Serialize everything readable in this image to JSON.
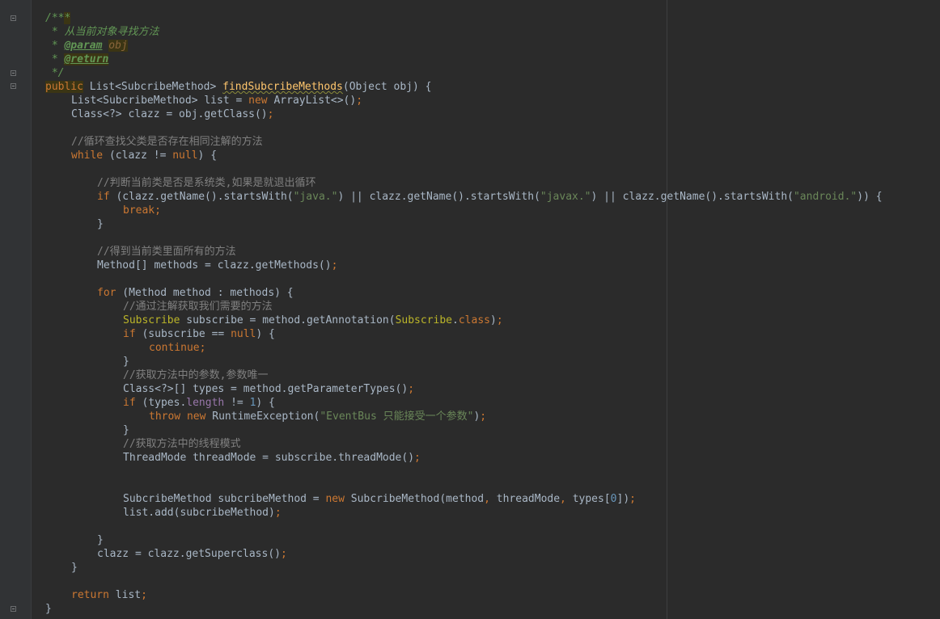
{
  "editor": {
    "language": "java",
    "lines": [
      {
        "indent": 56,
        "segs": [
          {
            "t": "/**",
            "c": "d"
          },
          {
            "t": "*",
            "c": "d hl"
          }
        ]
      },
      {
        "indent": 56,
        "segs": [
          {
            "t": " * 从当前对象寻找方法",
            "c": "d"
          }
        ]
      },
      {
        "indent": 56,
        "segs": [
          {
            "t": " * ",
            "c": "d"
          },
          {
            "t": "@param",
            "c": "dt"
          },
          {
            "t": " ",
            "c": "d"
          },
          {
            "t": "obj",
            "c": "prm"
          }
        ]
      },
      {
        "indent": 56,
        "segs": [
          {
            "t": " * ",
            "c": "d"
          },
          {
            "t": "@return",
            "c": "dt hl"
          }
        ]
      },
      {
        "indent": 56,
        "segs": [
          {
            "t": " */",
            "c": "d"
          }
        ]
      },
      {
        "indent": 56,
        "segs": [
          {
            "t": "public",
            "c": "k hl"
          },
          {
            "t": " List<SubcribeMethod> "
          },
          {
            "t": "findSubcribeMethods",
            "c": "f squig"
          },
          {
            "t": "(Object obj) {"
          }
        ]
      },
      {
        "indent": 88,
        "segs": [
          {
            "t": "List<SubcribeMethod> list = "
          },
          {
            "t": "new",
            "c": "k"
          },
          {
            "t": " ArrayList<>()"
          },
          {
            "t": ";",
            "c": "k"
          }
        ]
      },
      {
        "indent": 88,
        "segs": [
          {
            "t": "Class<?> clazz = obj.getClass()"
          },
          {
            "t": ";",
            "c": "k"
          }
        ]
      },
      {
        "indent": 88,
        "segs": []
      },
      {
        "indent": 88,
        "segs": [
          {
            "t": "//循环查找父类是否存在相同注解的方法",
            "c": "c"
          }
        ]
      },
      {
        "indent": 88,
        "segs": [
          {
            "t": "while",
            "c": "k"
          },
          {
            "t": " (clazz != "
          },
          {
            "t": "null",
            "c": "k"
          },
          {
            "t": ") {"
          }
        ]
      },
      {
        "indent": 88,
        "segs": []
      },
      {
        "indent": 120,
        "segs": [
          {
            "t": "//判断当前类是否是系统类,如果是就退出循环",
            "c": "c"
          }
        ]
      },
      {
        "indent": 120,
        "segs": [
          {
            "t": "if",
            "c": "k"
          },
          {
            "t": " (clazz.getName().startsWith("
          },
          {
            "t": "\"java.\"",
            "c": "s"
          },
          {
            "t": ") || clazz.getName().startsWith("
          },
          {
            "t": "\"javax.\"",
            "c": "s"
          },
          {
            "t": ") || clazz.getName().startsWith("
          },
          {
            "t": "\"android.\"",
            "c": "s"
          },
          {
            "t": ")) {"
          }
        ]
      },
      {
        "indent": 152,
        "segs": [
          {
            "t": "break;",
            "c": "k"
          }
        ]
      },
      {
        "indent": 120,
        "segs": [
          {
            "t": "}"
          }
        ]
      },
      {
        "indent": 120,
        "segs": []
      },
      {
        "indent": 120,
        "segs": [
          {
            "t": "//得到当前类里面所有的方法",
            "c": "c"
          }
        ]
      },
      {
        "indent": 120,
        "segs": [
          {
            "t": "Method[] methods = clazz.getMethods()"
          },
          {
            "t": ";",
            "c": "k"
          }
        ]
      },
      {
        "indent": 120,
        "segs": []
      },
      {
        "indent": 120,
        "segs": [
          {
            "t": "for",
            "c": "k"
          },
          {
            "t": " (Method method : methods) {"
          }
        ]
      },
      {
        "indent": 152,
        "segs": [
          {
            "t": "//通过注解获取我们需要的方法",
            "c": "c"
          }
        ]
      },
      {
        "indent": 152,
        "segs": [
          {
            "t": "Subscribe",
            "c": "an"
          },
          {
            "t": " subscribe = method.getAnnotation("
          },
          {
            "t": "Subscribe",
            "c": "an"
          },
          {
            "t": "."
          },
          {
            "t": "class",
            "c": "k"
          },
          {
            "t": ")"
          },
          {
            "t": ";",
            "c": "k"
          }
        ]
      },
      {
        "indent": 152,
        "segs": [
          {
            "t": "if",
            "c": "k"
          },
          {
            "t": " (subscribe == "
          },
          {
            "t": "null",
            "c": "k"
          },
          {
            "t": ") {"
          }
        ]
      },
      {
        "indent": 184,
        "segs": [
          {
            "t": "continue;",
            "c": "k"
          }
        ]
      },
      {
        "indent": 152,
        "segs": [
          {
            "t": "}"
          }
        ]
      },
      {
        "indent": 152,
        "segs": [
          {
            "t": "//获取方法中的参数,参数唯一",
            "c": "c"
          }
        ]
      },
      {
        "indent": 152,
        "segs": [
          {
            "t": "Class<?>[] types = method.getParameterTypes()"
          },
          {
            "t": ";",
            "c": "k"
          }
        ]
      },
      {
        "indent": 152,
        "segs": [
          {
            "t": "if",
            "c": "k"
          },
          {
            "t": " (types."
          },
          {
            "t": "length",
            "c": "pu"
          },
          {
            "t": " != "
          },
          {
            "t": "1",
            "c": "n"
          },
          {
            "t": ") {"
          }
        ]
      },
      {
        "indent": 184,
        "segs": [
          {
            "t": "throw new",
            "c": "k"
          },
          {
            "t": " RuntimeException("
          },
          {
            "t": "\"EventBus 只能接受一个参数\"",
            "c": "s"
          },
          {
            "t": ")"
          },
          {
            "t": ";",
            "c": "k"
          }
        ]
      },
      {
        "indent": 152,
        "segs": [
          {
            "t": "}"
          }
        ]
      },
      {
        "indent": 152,
        "segs": [
          {
            "t": "//获取方法中的线程模式",
            "c": "c"
          }
        ]
      },
      {
        "indent": 152,
        "segs": [
          {
            "t": "ThreadMode threadMode = subscribe.threadMode()"
          },
          {
            "t": ";",
            "c": "k"
          }
        ]
      },
      {
        "indent": 152,
        "segs": []
      },
      {
        "indent": 152,
        "segs": []
      },
      {
        "indent": 152,
        "segs": [
          {
            "t": "SubcribeMethod subcribeMethod = "
          },
          {
            "t": "new",
            "c": "k"
          },
          {
            "t": " SubcribeMethod(method"
          },
          {
            "t": ",",
            "c": "k"
          },
          {
            "t": " threadMode"
          },
          {
            "t": ",",
            "c": "k"
          },
          {
            "t": " types["
          },
          {
            "t": "0",
            "c": "n"
          },
          {
            "t": "])"
          },
          {
            "t": ";",
            "c": "k"
          }
        ]
      },
      {
        "indent": 152,
        "segs": [
          {
            "t": "list.add(subcribeMethod)"
          },
          {
            "t": ";",
            "c": "k"
          }
        ]
      },
      {
        "indent": 152,
        "segs": []
      },
      {
        "indent": 120,
        "segs": [
          {
            "t": "}"
          }
        ]
      },
      {
        "indent": 120,
        "segs": [
          {
            "t": "clazz = clazz.getSuperclass()"
          },
          {
            "t": ";",
            "c": "k"
          }
        ]
      },
      {
        "indent": 88,
        "segs": [
          {
            "t": "}"
          }
        ]
      },
      {
        "indent": 88,
        "segs": []
      },
      {
        "indent": 88,
        "segs": [
          {
            "t": "return",
            "c": "k"
          },
          {
            "t": " list"
          },
          {
            "t": ";",
            "c": "k"
          }
        ]
      },
      {
        "indent": 56,
        "segs": [
          {
            "t": "}"
          }
        ]
      }
    ]
  }
}
